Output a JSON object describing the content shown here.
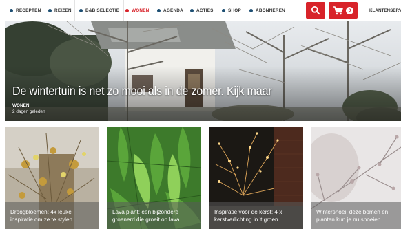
{
  "nav": {
    "items": [
      {
        "label": "RECEPTEN"
      },
      {
        "label": "REIZEN"
      },
      {
        "label": "B&B SELECTIE"
      },
      {
        "label": "WONEN"
      },
      {
        "label": "AGENDA"
      },
      {
        "label": "ACTIES"
      },
      {
        "label": "SHOP"
      },
      {
        "label": "ABONNEREN"
      }
    ],
    "search_icon": "search-icon",
    "cart_icon": "cart-icon",
    "cart_count": "0",
    "account_label": "KLANTENSERVICE"
  },
  "hero": {
    "title": "De wintertuin is net zo mooi als in de zomer. Kijk maar",
    "category": "WONEN",
    "time": "2 dagen geleden"
  },
  "cards": [
    {
      "line1": "Droogbloemen: 4x leuke",
      "line2": "inspiratie om ze te stylen"
    },
    {
      "line1": "Lava plant: een bijzondere",
      "line2": "groenerd die groeit op lava"
    },
    {
      "line1": "Inspiratie voor de kerst: 4 x",
      "line2": "kerstverlichting in 't groen"
    },
    {
      "line1": "Wintersnoei: deze bomen en",
      "line2": "planten kun je nu snoeien"
    }
  ],
  "colors": {
    "accent": "#d8232a",
    "nav_dot": "#1d4f73"
  }
}
